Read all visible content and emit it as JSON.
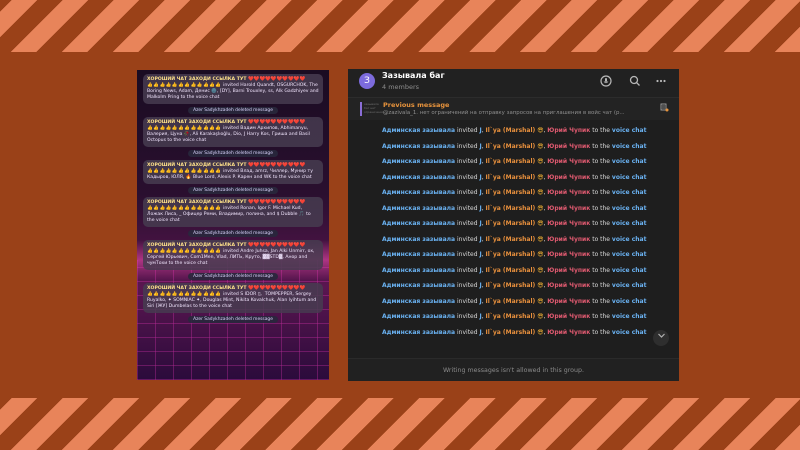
{
  "left_phone": {
    "invite_header": "ХОРОШИЙ ЧАТ ЗАХОДИ ССЫЛКА ТУТ",
    "emoji_row": "👍👍👍👍👍👍👍👍👍👍👍👍",
    "hearts_row": "❤️❤️❤️❤️❤️❤️❤️❤️❤️❤️",
    "deleted_notice": "Azer Sadykhzadeh deleted message",
    "blocks": [
      {
        "text": "invited Harold Quandt, OSGURCHOK, The Boring News, Adam, Денис 🌚, [DY], Barni Trouxley, ss, Alk Gadzhiyev and Malkolm Pring to the voice chat"
      },
      {
        "text": "invited Вадим Архипов, Abhimanyu, Валерия, Цуна 🥀, Ali Karakaşlıoğlu, Dio, J Harry Kos, Гриша and Basil Octopus to the voice chat"
      },
      {
        "text": "invited Влад, amrz, Чиллер, Мунир ту Кадыров, ЮЛЯ, 🔥 Blue Lord, Alexis P. Карен and WK to the voice chat"
      },
      {
        "text": "invited Ronan, Igor F. Michael Kud, Ложак Лиса, _ Офицер Реми, Владимир, полина, and $ Dubble 🎵 to the voice chat"
      },
      {
        "text": "invited Andre Juhsa, Jan Alki Unmirr, ox, Сергей Юрьевич, Com1Men, Vlad, ЛИТЬ, Круто, ▓▓STD▓, Анор and чумТохи to the voice chat"
      },
      {
        "text": "invited S IDOR ▯, ‍ TOMPEPPER, Sergey Ruyalko, ✦ SOMNIAC ✦, Douglas Mint, Nikita Kovalchuk, Alan lyihtum and Siri [ЖУ] Dumbelas to the voice chat"
      }
    ]
  },
  "chat": {
    "avatar_letter": "З",
    "title": "Зазывала баг",
    "subtitle": "4 members",
    "pinned_title": "Previous message",
    "pinned_text": "@zazivala_1. нет ограничений на отправку запросов на приглашения в войс чат (р...",
    "pinned_preview": "зазывала баг нет ограничений",
    "message": {
      "user1": "Админская зазывала",
      "verb1": " invited ",
      "user2": "J",
      "sep1": ", ",
      "user3": "Il`ya (Marshal)",
      "emoji": " 😎",
      "sep2": ", ",
      "user4": "Юрий Чупик",
      "verb2": " to the ",
      "voice": "voice chat"
    },
    "repeat_count": 14,
    "footer_text": "Writing messages isn't allowed in this group.",
    "icons": {
      "voice": "voice-chat-icon",
      "search": "search-icon",
      "more": "more-icon",
      "scroll": "chevron-down-icon",
      "pin": "pin-list-icon"
    }
  }
}
